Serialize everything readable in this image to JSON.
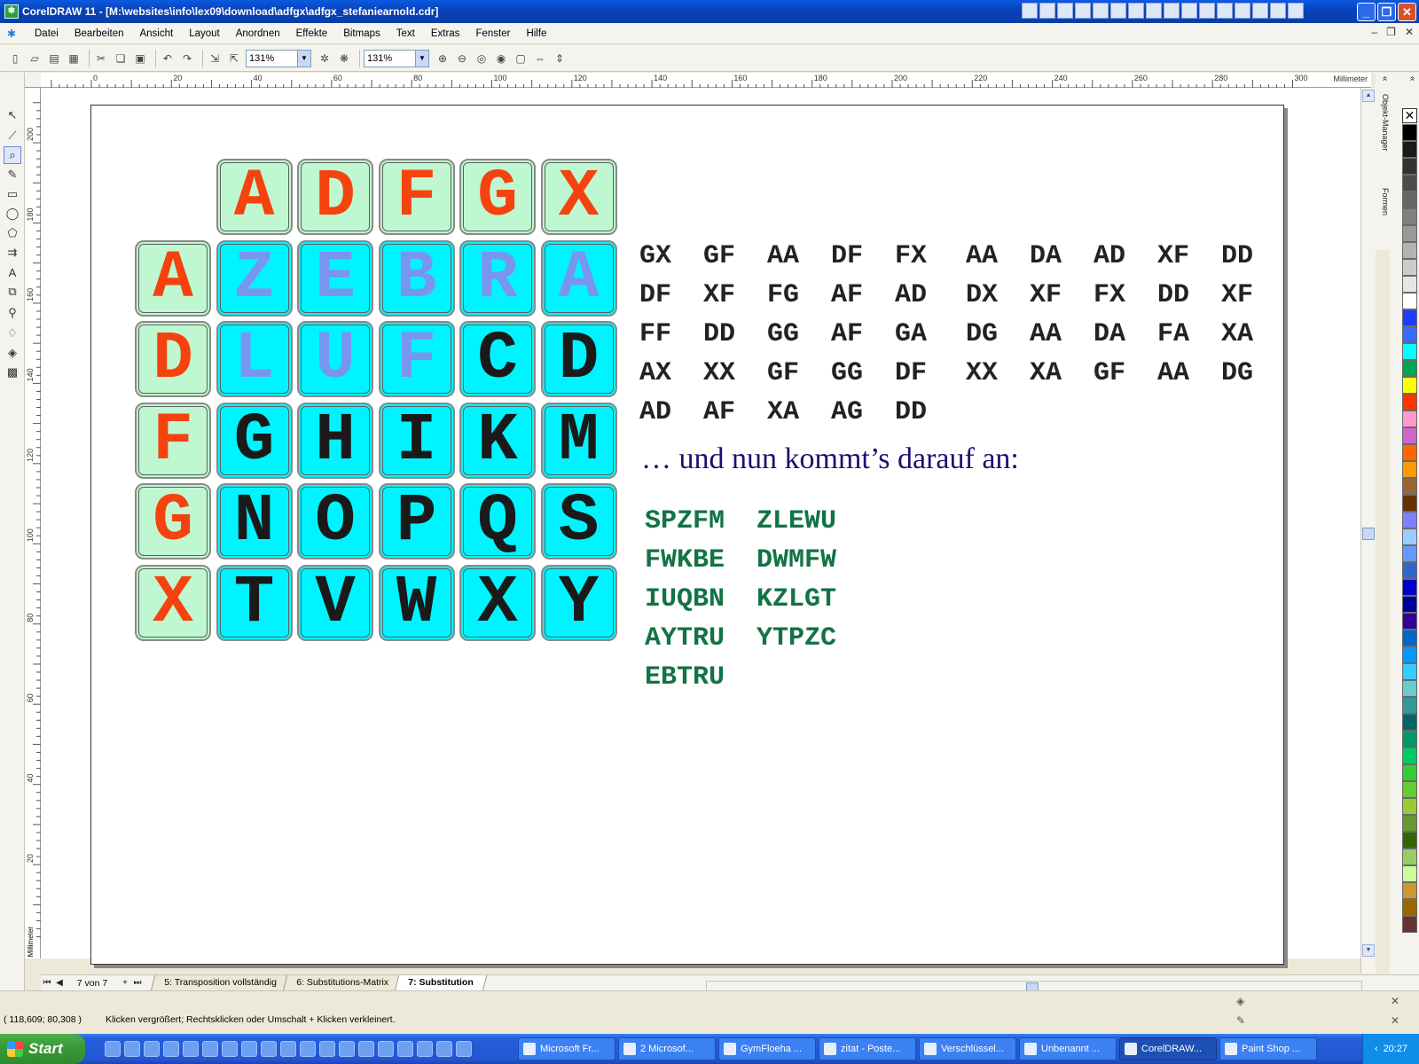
{
  "window": {
    "title": "CorelDRAW 11 - [M:\\websites\\info\\lex09\\download\\adfgx\\adfgx_stefaniearnold.cdr]",
    "colors": {
      "titlebar": "#0842b8",
      "cell_header": "#bff8d0",
      "cell_matrix": "#00f4ff",
      "header_letter": "#f5420f",
      "key_letter": "#7896f0",
      "tagline": "#1a1170",
      "codes": "#127345"
    }
  },
  "menu": {
    "items": [
      "Datei",
      "Bearbeiten",
      "Ansicht",
      "Layout",
      "Anordnen",
      "Effekte",
      "Bitmaps",
      "Text",
      "Extras",
      "Fenster",
      "Hilfe"
    ]
  },
  "toolbar": {
    "zoom_left": "131%",
    "zoom_right": "131%"
  },
  "rulers": {
    "h_labels": [
      "0",
      "20",
      "40",
      "60",
      "80",
      "100",
      "120",
      "140",
      "160",
      "180",
      "200",
      "220",
      "240",
      "260",
      "280",
      "300"
    ],
    "h_unit": "Millimeter",
    "v_labels": [
      "200",
      "180",
      "160",
      "140",
      "120",
      "100",
      "80",
      "60",
      "40",
      "20"
    ],
    "v_unit": "Millimeter"
  },
  "dockers": {
    "tabs": [
      "Objekt-Manager",
      "Formen"
    ]
  },
  "matrix": {
    "header_row": [
      "A",
      "D",
      "F",
      "G",
      "X"
    ],
    "header_col": [
      "A",
      "D",
      "F",
      "G",
      "X"
    ],
    "rows": [
      [
        "Z",
        "E",
        "B",
        "R",
        "A"
      ],
      [
        "L",
        "U",
        "F",
        "C",
        "D"
      ],
      [
        "G",
        "H",
        "I",
        "K",
        "M"
      ],
      [
        "N",
        "O",
        "P",
        "Q",
        "S"
      ],
      [
        "T",
        "V",
        "W",
        "X",
        "Y"
      ]
    ],
    "key_letters": "ZEBRALUF"
  },
  "pairs_left": [
    "GX  GF  AA  DF  FX",
    "DF  XF  FG  AF  AD",
    "FF  DD  GG  AF  GA",
    "AX  XX  GF  GG  DF",
    "AD  AF  XA  AG  DD"
  ],
  "pairs_right": [
    "AA  DA  AD  XF  DD",
    "DX  XF  FX  DD  XF",
    "DG  AA  DA  FA  XA",
    "XX  XA  GF  AA  DG"
  ],
  "tagline": "… und nun kommt’s darauf an:",
  "codes": [
    "SPZFM  ZLEWU",
    "FWKBE  DWMFW",
    "IUQBN  KZLGT",
    "AYTRU  YTPZC",
    "EBTRU"
  ],
  "page_nav": {
    "counter": "7 von 7",
    "tabs": [
      "5: Transposition vollständig",
      "6: Substitutions-Matrix",
      "7: Substitution"
    ],
    "active_tab": 2
  },
  "status": {
    "coords": "( 118,609; 80,308 )",
    "hint": "Klicken vergrößert; Rechtsklicken oder Umschalt + Klicken verkleinert."
  },
  "taskbar": {
    "start_label": "Start",
    "tasks": [
      "Microsoft Fr...",
      "2 Microsof...",
      "GymFloeha ...",
      "zitat - Poste...",
      "Verschlüssel...",
      "Unbenannt ...",
      "CorelDRAW...",
      "Paint Shop ..."
    ],
    "active_task": 6,
    "clock": "20:27"
  },
  "palette": [
    "#000000",
    "#1a1a1a",
    "#333333",
    "#4d4d4d",
    "#666666",
    "#808080",
    "#999999",
    "#b3b3b3",
    "#cccccc",
    "#e6e6e6",
    "#ffffff",
    "#1e3cff",
    "#3a6bff",
    "#00ffff",
    "#00a651",
    "#ffff00",
    "#ff3300",
    "#ff99cc",
    "#cc66cc",
    "#ff6600",
    "#ff9900",
    "#996633",
    "#663300",
    "#7f7fff",
    "#99ccff",
    "#6699ff",
    "#3366cc",
    "#0000cc",
    "#000099",
    "#330099",
    "#0066cc",
    "#0099ff",
    "#33ccff",
    "#66cccc",
    "#339999",
    "#006666",
    "#009966",
    "#00cc66",
    "#33cc33",
    "#66cc33",
    "#99cc33",
    "#669933",
    "#336600",
    "#99cc66",
    "#ccff99",
    "#cc9933",
    "#996600",
    "#663333"
  ]
}
